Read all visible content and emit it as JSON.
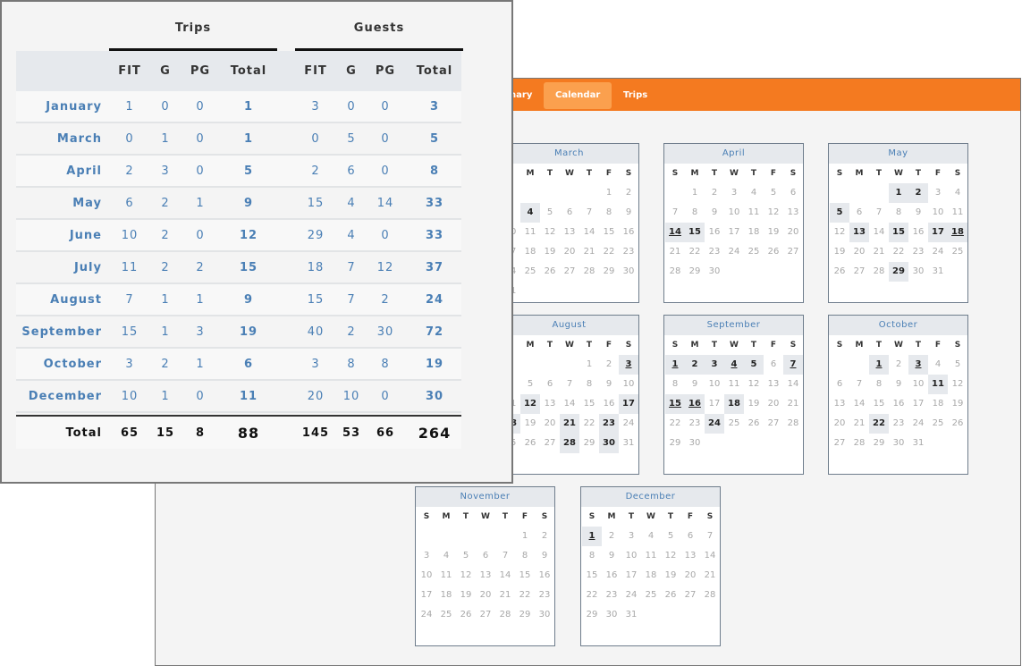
{
  "nav": {
    "tabs": [
      {
        "label": "Summary",
        "active": false
      },
      {
        "label": "Calendar",
        "active": true
      },
      {
        "label": "Trips",
        "active": false
      }
    ]
  },
  "calendar": {
    "weekdays": [
      "S",
      "M",
      "T",
      "W",
      "T",
      "F",
      "S"
    ],
    "months": [
      {
        "name": "March",
        "first_weekday": 5,
        "days": 31,
        "highlighted": [
          4
        ],
        "underlined": []
      },
      {
        "name": "April",
        "first_weekday": 1,
        "days": 30,
        "highlighted": [
          14,
          15
        ],
        "underlined": [
          14
        ]
      },
      {
        "name": "May",
        "first_weekday": 3,
        "days": 31,
        "highlighted": [
          1,
          2,
          5,
          13,
          15,
          17,
          18,
          29
        ],
        "underlined": [
          18
        ]
      },
      {
        "name": "August",
        "first_weekday": 4,
        "days": 31,
        "highlighted": [
          3,
          12,
          17,
          18,
          21,
          23,
          28,
          30
        ],
        "underlined": [
          3
        ]
      },
      {
        "name": "September",
        "first_weekday": 0,
        "days": 30,
        "highlighted": [
          1,
          2,
          3,
          4,
          5,
          7,
          15,
          16,
          18,
          24
        ],
        "underlined": [
          1,
          4,
          7,
          15,
          16
        ]
      },
      {
        "name": "October",
        "first_weekday": 2,
        "days": 31,
        "highlighted": [
          1,
          3,
          11,
          22
        ],
        "underlined": [
          1,
          3
        ]
      },
      {
        "name": "November",
        "first_weekday": 5,
        "days": 30,
        "highlighted": [],
        "underlined": []
      },
      {
        "name": "December",
        "first_weekday": 0,
        "days": 31,
        "highlighted": [
          1
        ],
        "underlined": [
          1
        ]
      }
    ]
  },
  "table": {
    "groups": [
      "Trips",
      "Guests"
    ],
    "columns": [
      "FIT",
      "G",
      "PG",
      "Total"
    ],
    "rows": [
      {
        "month": "January",
        "trips": [
          1,
          0,
          0,
          1
        ],
        "guests": [
          3,
          0,
          0,
          3
        ]
      },
      {
        "month": "March",
        "trips": [
          0,
          1,
          0,
          1
        ],
        "guests": [
          0,
          5,
          0,
          5
        ]
      },
      {
        "month": "April",
        "trips": [
          2,
          3,
          0,
          5
        ],
        "guests": [
          2,
          6,
          0,
          8
        ]
      },
      {
        "month": "May",
        "trips": [
          6,
          2,
          1,
          9
        ],
        "guests": [
          15,
          4,
          14,
          33
        ]
      },
      {
        "month": "June",
        "trips": [
          10,
          2,
          0,
          12
        ],
        "guests": [
          29,
          4,
          0,
          33
        ]
      },
      {
        "month": "July",
        "trips": [
          11,
          2,
          2,
          15
        ],
        "guests": [
          18,
          7,
          12,
          37
        ]
      },
      {
        "month": "August",
        "trips": [
          7,
          1,
          1,
          9
        ],
        "guests": [
          15,
          7,
          2,
          24
        ]
      },
      {
        "month": "September",
        "trips": [
          15,
          1,
          3,
          19
        ],
        "guests": [
          40,
          2,
          30,
          72
        ]
      },
      {
        "month": "October",
        "trips": [
          3,
          2,
          1,
          6
        ],
        "guests": [
          3,
          8,
          8,
          19
        ]
      },
      {
        "month": "December",
        "trips": [
          10,
          1,
          0,
          11
        ],
        "guests": [
          20,
          10,
          0,
          30
        ]
      }
    ],
    "total": {
      "label": "Total",
      "trips": [
        65,
        15,
        8,
        88
      ],
      "guests": [
        145,
        53,
        66,
        264
      ]
    }
  },
  "colors": {
    "accent": "#f47a20",
    "active_tab": "#fba04e",
    "link": "#4a7fb5",
    "highlight": "#e6e9ed"
  }
}
